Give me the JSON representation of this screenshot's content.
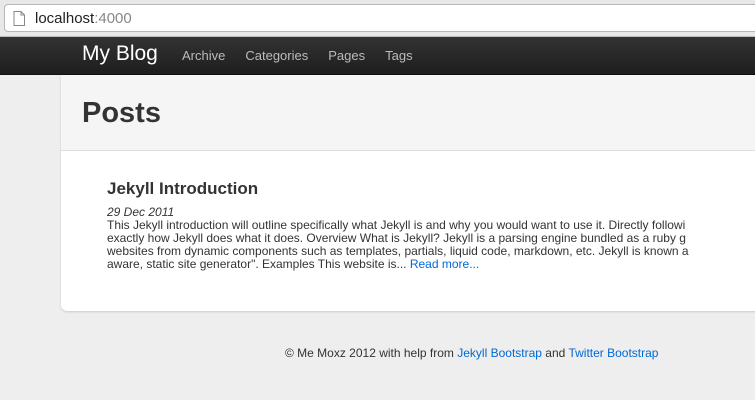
{
  "browser": {
    "url_host": "localhost",
    "url_port": ":4000"
  },
  "navbar": {
    "brand": "My Blog",
    "links": [
      "Archive",
      "Categories",
      "Pages",
      "Tags"
    ]
  },
  "page": {
    "title": "Posts"
  },
  "post": {
    "title": "Jekyll Introduction",
    "date": "29 Dec 2011",
    "excerpt_lines": [
      "This Jekyll introduction will outline specifically what Jekyll is and why you would want to use it. Directly followi",
      "exactly how Jekyll does what it does. Overview What is Jekyll? Jekyll is a parsing engine bundled as a ruby g",
      "websites from dynamic components such as templates, partials, liquid code, markdown, etc. Jekyll is known a",
      "aware, static site generator\". Examples This website is... "
    ],
    "read_more": "Read more..."
  },
  "footer": {
    "prefix": "© Me Moxz 2012 with help from ",
    "link1": "Jekyll Bootstrap",
    "middle": " and ",
    "link2": "Twitter Bootstrap"
  },
  "colors": {
    "navbar": "#222222",
    "link": "#0069d6",
    "background": "#eeeeee"
  }
}
